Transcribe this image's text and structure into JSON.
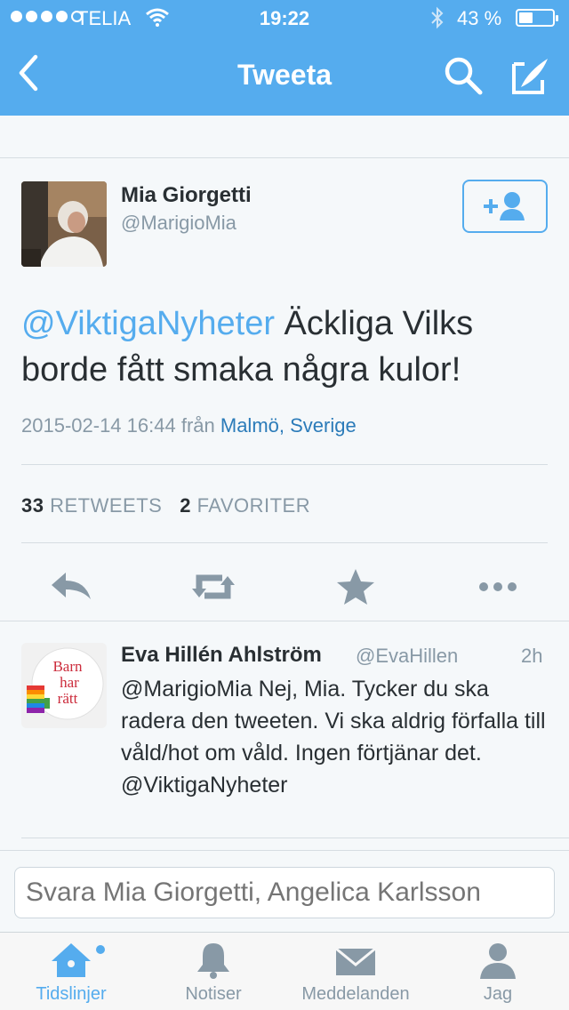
{
  "status_bar": {
    "carrier": "TELIA",
    "time": "19:22",
    "battery": "43 %",
    "battery_level": 0.43
  },
  "nav": {
    "title": "Tweeta",
    "back_icon": "chevron-left-icon",
    "search_icon": "search-icon",
    "compose_icon": "compose-icon"
  },
  "tweet": {
    "author_name": "Mia Giorgetti",
    "author_handle": "@MarigioMia",
    "mention": "@ViktigaNyheter",
    "text": " Äckliga Vilks borde fått smaka några kulor!",
    "timestamp": "2015-02-14 16:44",
    "from_label": "från",
    "location": "Malmö, Sverige",
    "retweets_count": "33",
    "retweets_label": "RETWEETS",
    "favorites_count": "2",
    "favorites_label": "FAVORITER"
  },
  "reply": {
    "author_name": "Eva Hillén Ahlström",
    "author_handle": "@EvaHillen",
    "time": "2h",
    "text": "@MarigioMia Nej, Mia. Tycker du ska radera den tweeten. Vi ska aldrig förfalla till våld/hot om våld. Ingen förtjänar det. @ViktigaNyheter",
    "avatar_text": [
      "Barn",
      "har",
      "rätt"
    ]
  },
  "compose": {
    "placeholder": "Svara Mia Giorgetti, Angelica Karlsson"
  },
  "tabs": [
    {
      "label": "Tidslinjer",
      "icon": "home-icon",
      "active": true
    },
    {
      "label": "Notiser",
      "icon": "bell-icon",
      "active": false
    },
    {
      "label": "Meddelanden",
      "icon": "envelope-icon",
      "active": false
    },
    {
      "label": "Jag",
      "icon": "person-icon",
      "active": false
    }
  ],
  "colors": {
    "accent": "#55acee",
    "link": "#2b7bb9",
    "text": "#292f33",
    "muted": "#8899a6"
  }
}
